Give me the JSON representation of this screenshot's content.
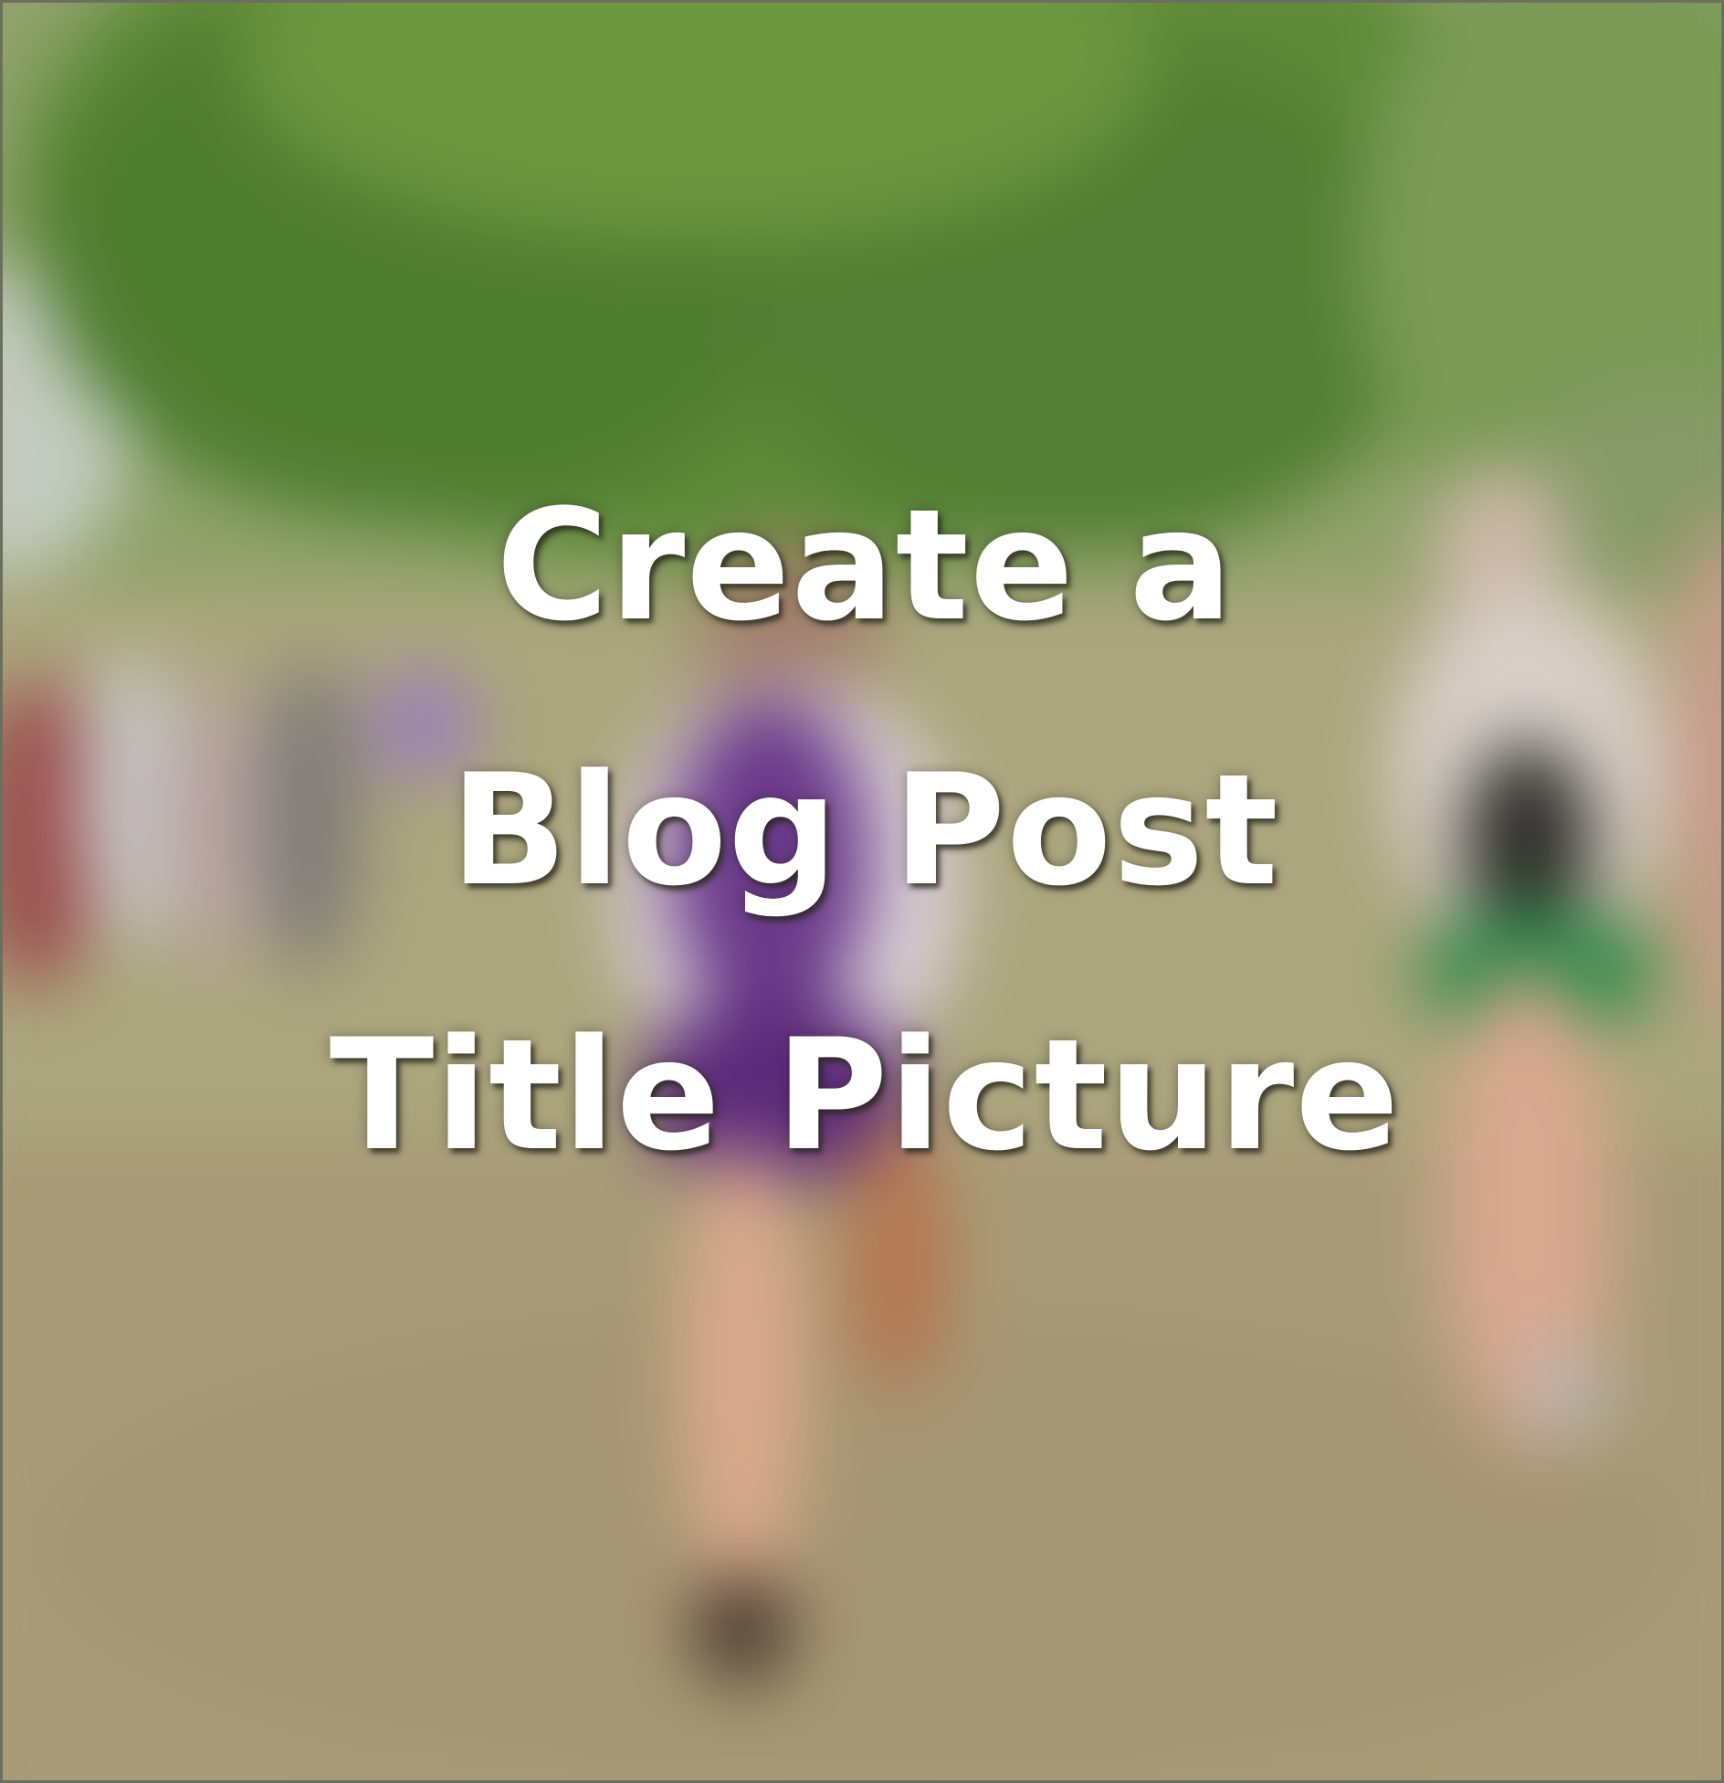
{
  "title_lines": [
    "Create a",
    "Blog Post",
    "Title Picture"
  ],
  "colors": {
    "foliage": "#5f8a3a",
    "grass": "#a8a57c",
    "runner_primary_uniform": "#6a3a8a",
    "runner_secondary_shorts": "#2f8a4a",
    "title_text": "#ffffff"
  }
}
